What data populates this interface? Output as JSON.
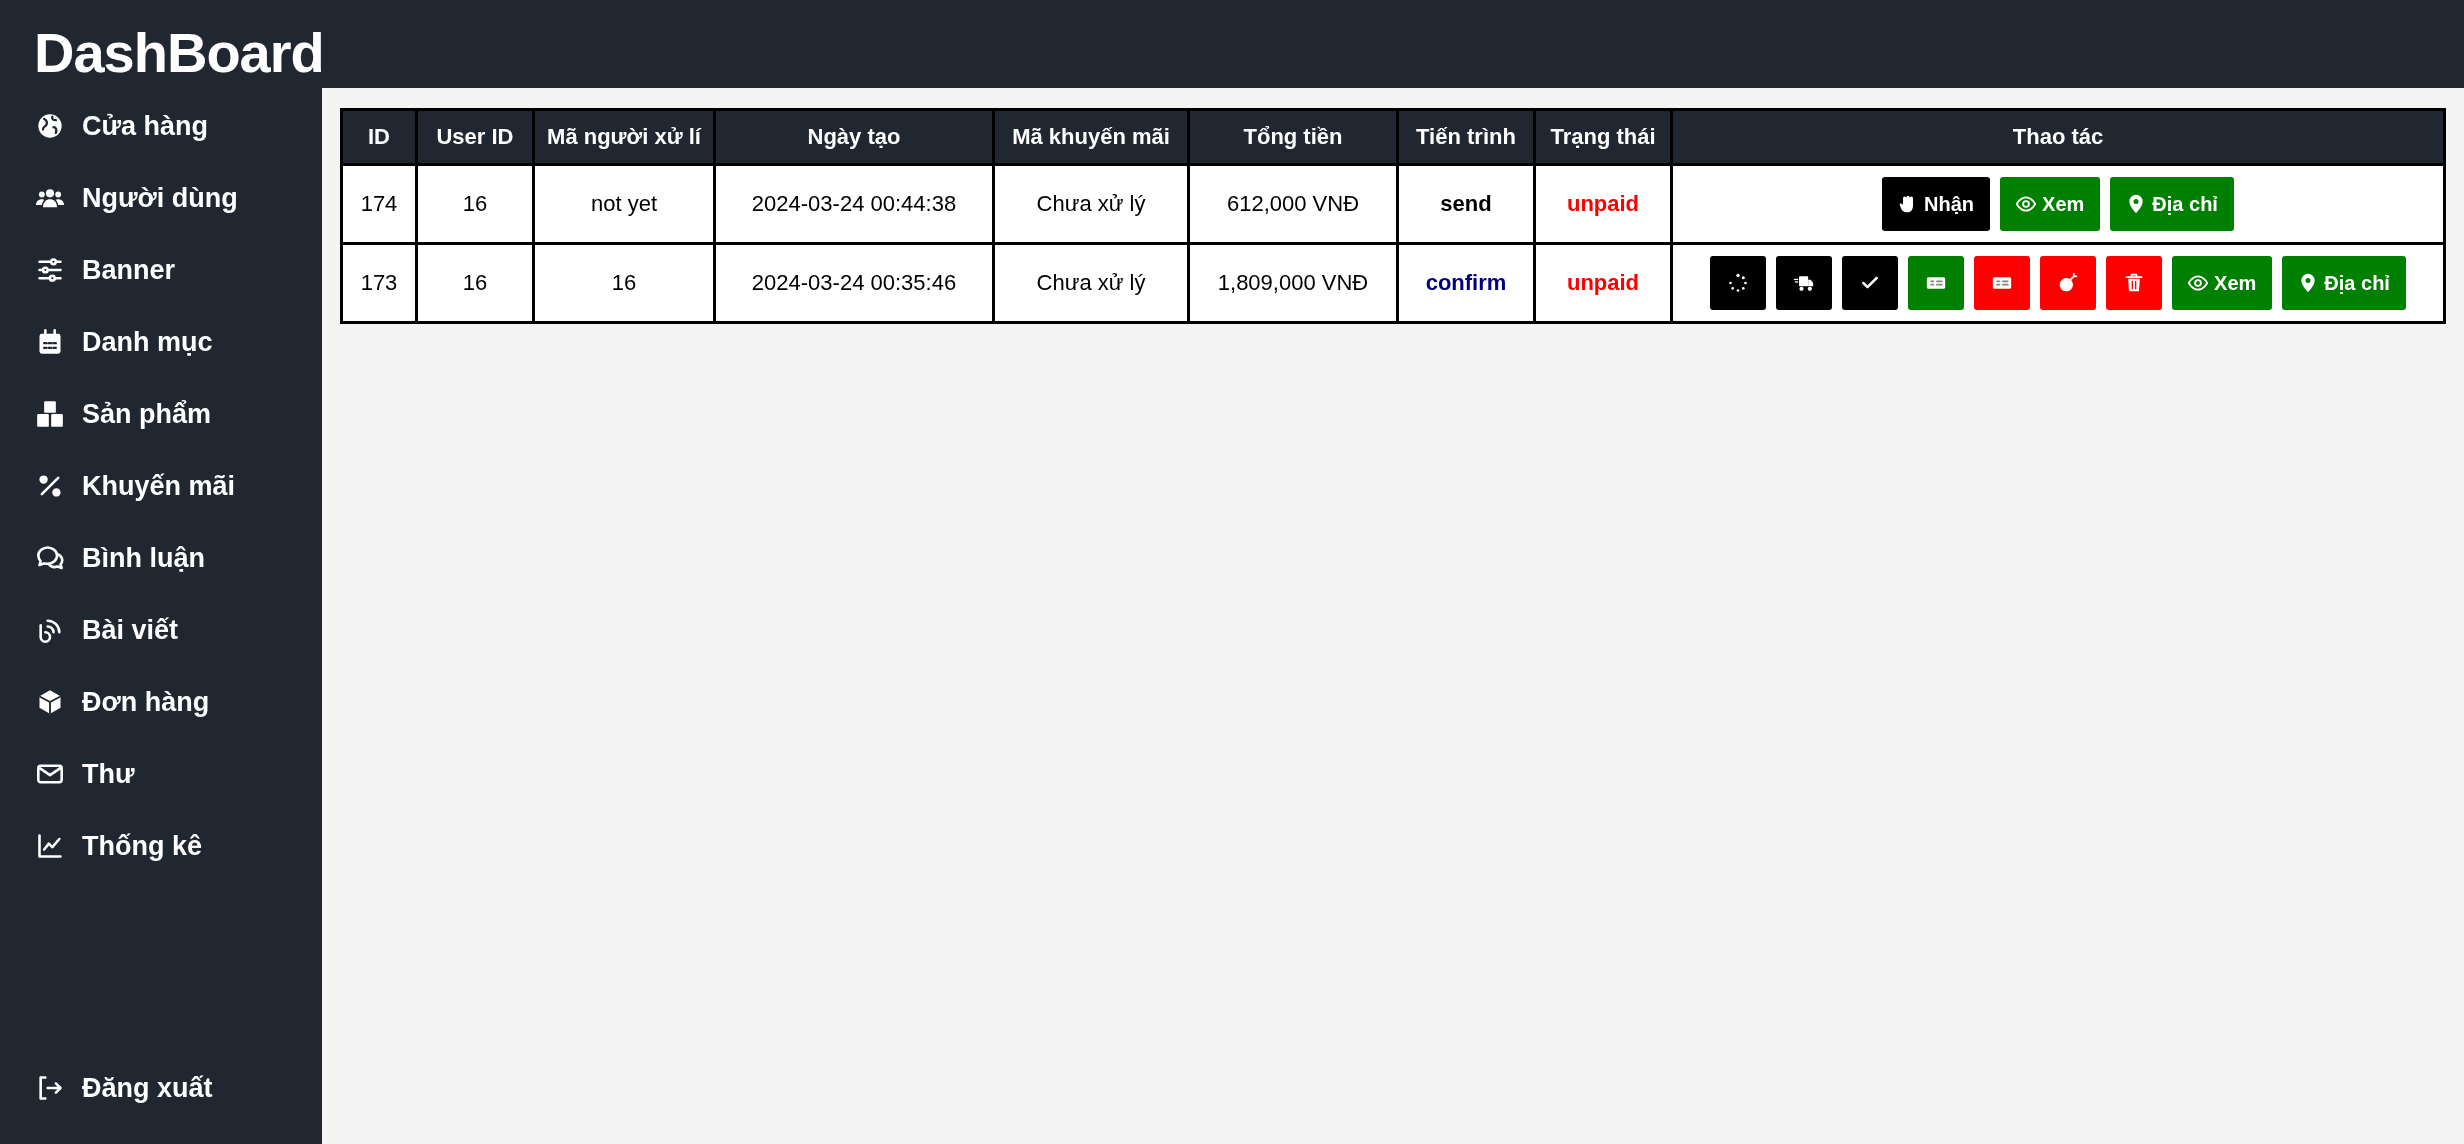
{
  "sidebar": {
    "title": "DashBoard",
    "items": [
      {
        "kind": "globe",
        "label": "Cửa hàng"
      },
      {
        "kind": "users",
        "label": "Người dùng"
      },
      {
        "kind": "sliders",
        "label": "Banner"
      },
      {
        "kind": "calendar",
        "label": "Danh mục"
      },
      {
        "kind": "boxes",
        "label": "Sản phẩm"
      },
      {
        "kind": "percent",
        "label": "Khuyến mãi"
      },
      {
        "kind": "comments",
        "label": "Bình luận"
      },
      {
        "kind": "feed",
        "label": "Bài viết"
      },
      {
        "kind": "cube",
        "label": "Đơn hàng"
      },
      {
        "kind": "envelope",
        "label": "Thư"
      },
      {
        "kind": "chart",
        "label": "Thống kê"
      }
    ],
    "logout": {
      "kind": "logout",
      "label": "Đăng xuất"
    }
  },
  "table": {
    "columns": [
      "ID",
      "User ID",
      "Mã người xử lí",
      "Ngày tạo",
      "Mã khuyến mãi",
      "Tổng tiền",
      "Tiến trình",
      "Trạng thái",
      "Thao tác"
    ],
    "rows": [
      {
        "id": "174",
        "user_id": "16",
        "handler": "not yet",
        "created": "2024-03-24 00:44:38",
        "promo": "Chưa xử lý",
        "total": "612,000 VNĐ",
        "process": {
          "text": "send",
          "color": "#000000"
        },
        "status": {
          "text": "unpaid",
          "color": "#ff0000"
        },
        "actions": [
          {
            "kind": "hand",
            "label": "Nhận",
            "color": "#000000"
          },
          {
            "kind": "eye",
            "label": "Xem",
            "color": "#008000"
          },
          {
            "kind": "pin",
            "label": "Địa chỉ",
            "color": "#008000"
          }
        ]
      },
      {
        "id": "173",
        "user_id": "16",
        "handler": "16",
        "created": "2024-03-24 00:35:46",
        "promo": "Chưa xử lý",
        "total": "1,809,000 VNĐ",
        "process": {
          "text": "confirm",
          "color": "#000080"
        },
        "status": {
          "text": "unpaid",
          "color": "#ff0000"
        },
        "actions": [
          {
            "kind": "spinner",
            "color": "#000000"
          },
          {
            "kind": "truck",
            "color": "#000000"
          },
          {
            "kind": "check",
            "color": "#000000"
          },
          {
            "kind": "money",
            "color": "#008000"
          },
          {
            "kind": "money",
            "color": "#ff0000"
          },
          {
            "kind": "bomb",
            "color": "#ff0000"
          },
          {
            "kind": "trash",
            "color": "#ff0000"
          },
          {
            "kind": "eye",
            "label": "Xem",
            "color": "#008000"
          },
          {
            "kind": "pin",
            "label": "Địa chỉ",
            "color": "#008000"
          }
        ]
      }
    ]
  }
}
